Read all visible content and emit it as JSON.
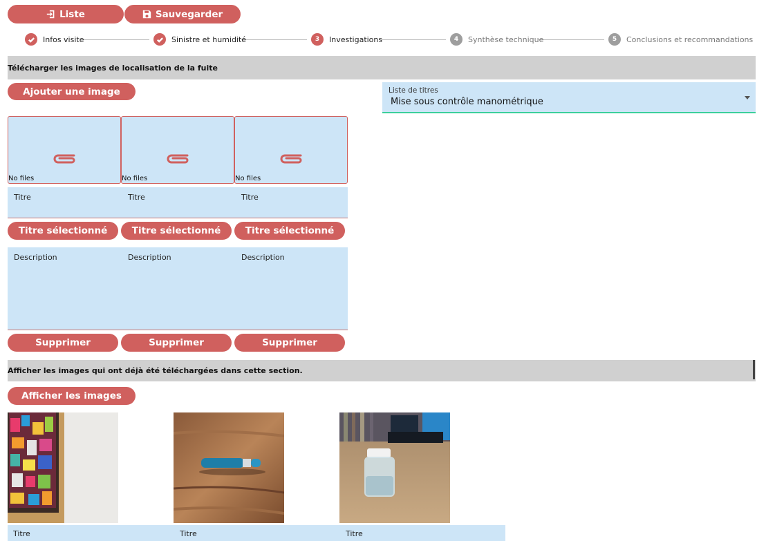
{
  "toolbar": {
    "list_label": "Liste",
    "save_label": "Sauvegarder"
  },
  "stepper": {
    "steps": [
      {
        "number": "1",
        "label": "Infos visite",
        "state": "done"
      },
      {
        "number": "2",
        "label": "Sinistre et humidité",
        "state": "done"
      },
      {
        "number": "3",
        "label": "Investigations",
        "state": "active"
      },
      {
        "number": "4",
        "label": "Synthèse technique",
        "state": "todo"
      },
      {
        "number": "5",
        "label": "Conclusions et recommandations",
        "state": "todo"
      }
    ]
  },
  "upload_section": {
    "heading": "Télécharger les images de localisation de la fuite",
    "add_button": "Ajouter une image",
    "title_list": {
      "label": "Liste de titres",
      "value": "Mise sous contrôle manométrique"
    },
    "tiles": [
      {
        "files": "No files",
        "title_label": "Titre",
        "select_button": "Titre sélectionné",
        "description_label": "Description",
        "delete_button": "Supprimer"
      },
      {
        "files": "No files",
        "title_label": "Titre",
        "select_button": "Titre sélectionné",
        "description_label": "Description",
        "delete_button": "Supprimer"
      },
      {
        "files": "No files",
        "title_label": "Titre",
        "select_button": "Titre sélectionné",
        "description_label": "Description",
        "delete_button": "Supprimer"
      }
    ]
  },
  "gallery_section": {
    "heading": "Afficher les images qui ont déjà été téléchargées dans cette section.",
    "show_button": "Afficher les images",
    "images": [
      {
        "title_label": "Titre"
      },
      {
        "title_label": "Titre"
      },
      {
        "title_label": "Titre"
      }
    ]
  },
  "colors": {
    "accent": "#d0605e",
    "field_bg": "#cde5f7",
    "section_bg": "#d0d0d0",
    "focus": "#3ccf9b",
    "inactive_step": "#9e9e9e"
  },
  "icons": {
    "list": "login-icon",
    "save": "floppy-disk-icon",
    "done_step": "check-icon",
    "attachment": "paperclip-icon",
    "select": "caret-down-icon"
  }
}
